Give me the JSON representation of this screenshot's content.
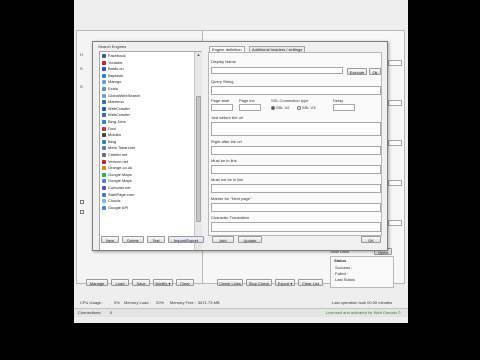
{
  "dialog": {
    "list_title": "Search Engines",
    "engines": [
      {
        "label": "Facebook",
        "color": "#3b5998"
      },
      {
        "label": "Youtube",
        "color": "#d62020"
      },
      {
        "label": "Baidu.cn",
        "color": "#2b4fd8"
      },
      {
        "label": "Bayseek",
        "color": "#3a7bd5"
      },
      {
        "label": "Mamgo",
        "color": "#66a3d8"
      },
      {
        "label": "Exalo",
        "color": "#5a8ed0"
      },
      {
        "label": "GlobalWebSearch",
        "color": "#7aa0c8"
      },
      {
        "label": "Marmmo",
        "color": "#3e6ab8"
      },
      {
        "label": "WebCrawler",
        "color": "#1f5fae"
      },
      {
        "label": "WebCrawler",
        "color": "#2a6ac0"
      },
      {
        "label": "Bing.Jobs",
        "color": "#3380cc"
      },
      {
        "label": "Doci",
        "color": "#cc3333"
      },
      {
        "label": "Mobibo",
        "color": "#444444"
      },
      {
        "label": "Bing",
        "color": "#2f7fc1"
      },
      {
        "label": "Meta Tsearcher",
        "color": "#4f82c6"
      },
      {
        "label": "Chiefer.net",
        "color": "#6d6d6d"
      },
      {
        "label": "Verizon.net",
        "color": "#cc2222"
      },
      {
        "label": "Orange.co.uk",
        "color": "#f07f0c"
      },
      {
        "label": "Google Maps",
        "color": "#3aa757"
      },
      {
        "label": "Google Maps",
        "color": "#4285f4"
      },
      {
        "label": "Comcast.net",
        "color": "#555599"
      },
      {
        "label": "StartPage.com",
        "color": "#4a7bc4"
      },
      {
        "label": "Clouds",
        "color": "#8db6e2"
      },
      {
        "label": "Google API",
        "color": "#4285f4"
      }
    ],
    "list_buttons": {
      "new": "New",
      "delete": "Delete",
      "test": "Test",
      "import_export": "Import/Export"
    },
    "tabs": {
      "definition": "Engine definition",
      "headers": "Additional headers / settings"
    },
    "fields": {
      "display_name": "Display Name",
      "query_string": "Query String",
      "page_start": "Page start",
      "page_inc": "Page inc",
      "ssl_type": "SSL Connection type",
      "delay": "Delay",
      "ssl_v2": "SSL V2",
      "ssl_v3": "SSL V3",
      "just_before": "Just before the url",
      "right_after": "Right after the url",
      "must_be_in_link": "Must be in link",
      "must_not_be_in_link": "Must not be in link",
      "marker_next": "Marker for \"Next page\"",
      "char_translation": "Character Translation"
    },
    "side_buttons": {
      "execute": "Execute",
      "ok_small": "Ok"
    },
    "bottom_buttons": {
      "add": "Add",
      "update": "Update",
      "ok": "OK"
    }
  },
  "main": {
    "footer_left_buttons": [
      "Manage",
      "Load",
      "Save",
      "Modify ▾",
      "Clear"
    ],
    "footer_right_buttons": [
      "Check Links",
      "Stop Check",
      "Export ▾",
      "Clear List"
    ],
    "slow_links_label": "Slow Links",
    "open_button": "Open",
    "status_title": "Status",
    "status_rows": [
      "Success :",
      "Failed :",
      "Last Status"
    ]
  },
  "statusbar": {
    "cpu": "CPU Usage :",
    "cpu_val": "0%",
    "mem_load": "Memory Load :",
    "mem_load_val": "20%",
    "mem_free": "Memory Free :",
    "mem_free_val": "5871.73 MB",
    "last_op": "Last operation took 00:00 minutes"
  },
  "bottombar": {
    "connections_label": "Connections:",
    "connections_val": "0",
    "status_text": "Licensed and activated for Web Domain ©",
    "status_color": "#2e8b2e"
  }
}
